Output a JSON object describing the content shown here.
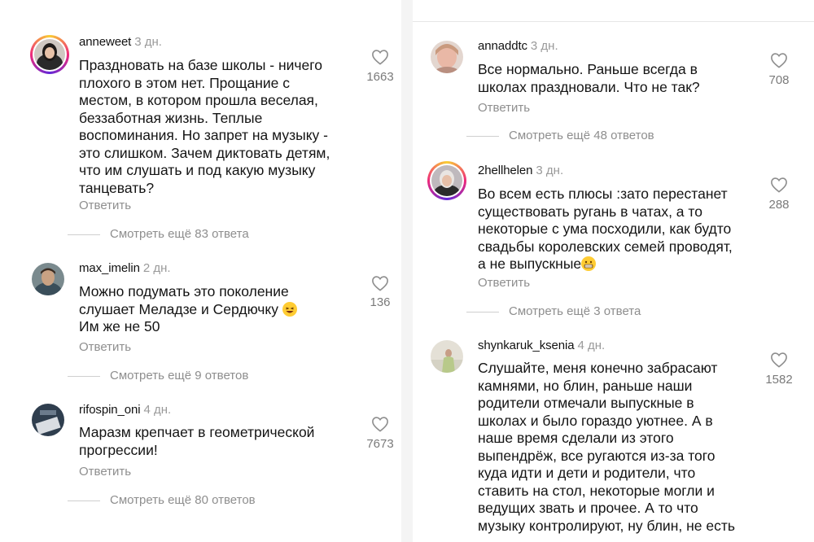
{
  "left_column": {
    "comments": [
      {
        "username": "anneweet",
        "time": "3 дн.",
        "text": "Праздновать на базе школы - ничего\nплохого в этом нет. Прощание с\nместом, в котором прошла веселая,\nбеззаботная жизнь. Теплые\nвоспоминания. Но запрет на музыку -\nэто слишком. Зачем диктовать детям,\nчто им слушать и под какую музыку\nтанцевать?",
        "likes": "1663",
        "reply": "Ответить",
        "more": "Смотреть ещё 83 ответа"
      },
      {
        "username": "max_imelin",
        "time": "2 дн.",
        "text_lines": [
          "Можно подумать это поколение",
          "слушает Меладзе и Сердючку",
          "Им же не 50"
        ],
        "likes": "136",
        "reply": "Ответить",
        "more": "Смотреть ещё 9 ответов"
      },
      {
        "username": "rifospin_oni",
        "time": "4 дн.",
        "text": "Маразм крепчает в геометрической\nпрогрессии!",
        "likes": "7673",
        "reply": "Ответить",
        "more": "Смотреть ещё 80 ответов"
      }
    ]
  },
  "right_column": {
    "comments": [
      {
        "username": "annaddtc",
        "time": "3 дн.",
        "text": "Все нормально.  Раньше всегда в\nшколах праздновали.  Что не так?",
        "likes": "708",
        "reply": "Ответить",
        "more": "Смотреть ещё 48 ответов"
      },
      {
        "username": "2hellhelen",
        "time": "3 дн.",
        "text_lines": [
          "Во всем есть плюсы :зато перестанет",
          "существовать ругань в чатах, а то",
          "некоторые с ума посходили, как будто",
          "свадьбы королевских семей проводят,",
          "а не выпускные"
        ],
        "likes": "288",
        "reply": "Ответить",
        "more": "Смотреть ещё 3 ответа"
      },
      {
        "username": "shynkaruk_ksenia",
        "time": "4 дн.",
        "text": "Слушайте, меня конечно забрасают\nкамнями, но блин, раньше наши\nродители отмечали выпускные в\nшколах и было гораздо уютнее. А в\nнаше время сделали из этого\nвыпендрёж, все ругаются из-за того\nкуда идти и дети и родители, что\nставить на стол, некоторые могли и\nведущих звать и прочее.  А то что\nмузыку контролируют, ну блин, не есть",
        "likes": "1582"
      }
    ]
  },
  "icons": {
    "like": "heart-outline-icon",
    "emoji_laugh": "grinning-squinting-emoji",
    "emoji_grimace": "grimacing-emoji"
  },
  "colors": {
    "text": "#141414",
    "muted": "#8e8e8e",
    "divider": "#cfcfcf",
    "story_ring": "#ee2a7b"
  }
}
